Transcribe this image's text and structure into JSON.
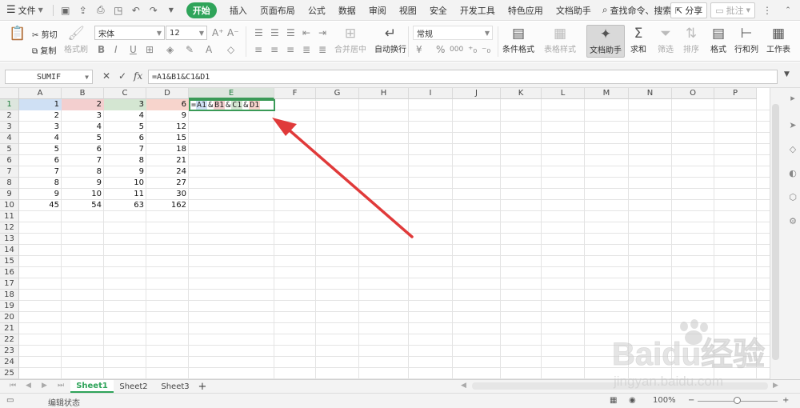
{
  "menubar": {
    "file_label": "文件",
    "items": [
      "开始",
      "插入",
      "页面布局",
      "公式",
      "数据",
      "审阅",
      "视图",
      "安全",
      "开发工具",
      "特色应用",
      "文档助手"
    ],
    "search_label": "查找命令、搜索模板",
    "share_label": "分享",
    "comment_label": "批注"
  },
  "ribbon": {
    "cut": "剪切",
    "copy": "复制",
    "format_painter": "格式刷",
    "font_name": "宋体",
    "font_size": "12",
    "merge_center": "合并居中",
    "wrap_text": "自动换行",
    "number_format": "常规",
    "conditional_format": "条件格式",
    "table_style": "表格样式",
    "doc_assistant": "文档助手",
    "sum": "求和",
    "filter": "筛选",
    "sort": "排序",
    "format": "格式",
    "rows_cols": "行和列",
    "worksheet": "工作表",
    "percent": "%",
    "thousands": "000"
  },
  "formula_bar": {
    "name_box": "SUMIF",
    "fx": "fx",
    "formula": "=A1&B1&C1&D1"
  },
  "grid": {
    "columns": [
      "A",
      "B",
      "C",
      "D",
      "E",
      "F",
      "G",
      "H",
      "I",
      "J",
      "K",
      "L",
      "M",
      "N",
      "O",
      "P"
    ],
    "rows": [
      "1",
      "2",
      "3",
      "4",
      "5",
      "6",
      "7",
      "8",
      "9",
      "10",
      "11",
      "12",
      "13",
      "14",
      "15",
      "16",
      "17",
      "18",
      "19",
      "20",
      "21",
      "22",
      "23",
      "24",
      "25"
    ],
    "data": [
      [
        "1",
        "2",
        "3",
        "6"
      ],
      [
        "2",
        "3",
        "4",
        "9"
      ],
      [
        "3",
        "4",
        "5",
        "12"
      ],
      [
        "4",
        "5",
        "6",
        "15"
      ],
      [
        "5",
        "6",
        "7",
        "18"
      ],
      [
        "6",
        "7",
        "8",
        "21"
      ],
      [
        "7",
        "8",
        "9",
        "24"
      ],
      [
        "8",
        "9",
        "10",
        "27"
      ],
      [
        "9",
        "10",
        "11",
        "30"
      ],
      [
        "45",
        "54",
        "63",
        "162"
      ]
    ],
    "edit_cell": {
      "eq": "=",
      "a": "A1",
      "amp1": "&",
      "b": "B1",
      "amp2": "&",
      "c": "C1",
      "amp3": "&",
      "d": "D1"
    }
  },
  "sheets": {
    "tabs": [
      "Sheet1",
      "Sheet2",
      "Sheet3"
    ],
    "add": "+"
  },
  "status": {
    "mode": "编辑状态",
    "zoom": "100%"
  },
  "watermark": {
    "text": "Baidu经验",
    "url": "jingyan.baidu.com"
  },
  "colors": {
    "accent": "#2fa45a",
    "arrow": "#e03a3a",
    "ref_a": "#cfe0f4",
    "ref_b": "#f3cfcf",
    "ref_c": "#d4e6d2",
    "ref_d": "#f7d4cc"
  }
}
